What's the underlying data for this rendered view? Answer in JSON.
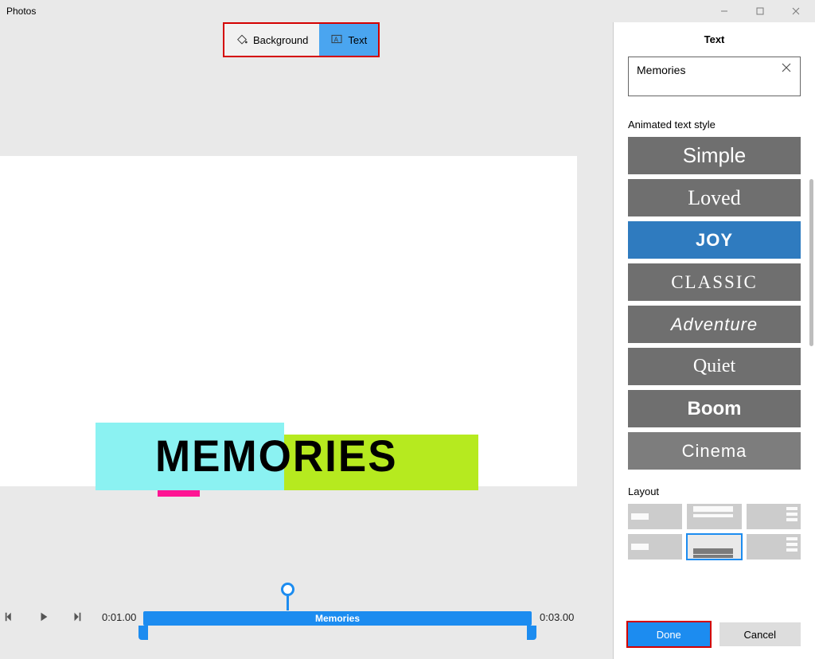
{
  "window": {
    "title": "Photos"
  },
  "top_tabs": {
    "background": "Background",
    "text": "Text"
  },
  "preview": {
    "title_text": "MEMORIES"
  },
  "timeline": {
    "start": "0:01.00",
    "end": "0:03.00",
    "clip_label": "Memories"
  },
  "panel": {
    "title": "Text",
    "input_value": "Memories",
    "style_heading": "Animated text style",
    "styles": {
      "simple": "Simple",
      "loved": "Loved",
      "joy": "JOY",
      "classic": "CLASSIC",
      "adventure": "Adventure",
      "quiet": "Quiet",
      "boom": "Boom",
      "cinema": "Cinema"
    },
    "layout_heading": "Layout",
    "done": "Done",
    "cancel": "Cancel"
  }
}
